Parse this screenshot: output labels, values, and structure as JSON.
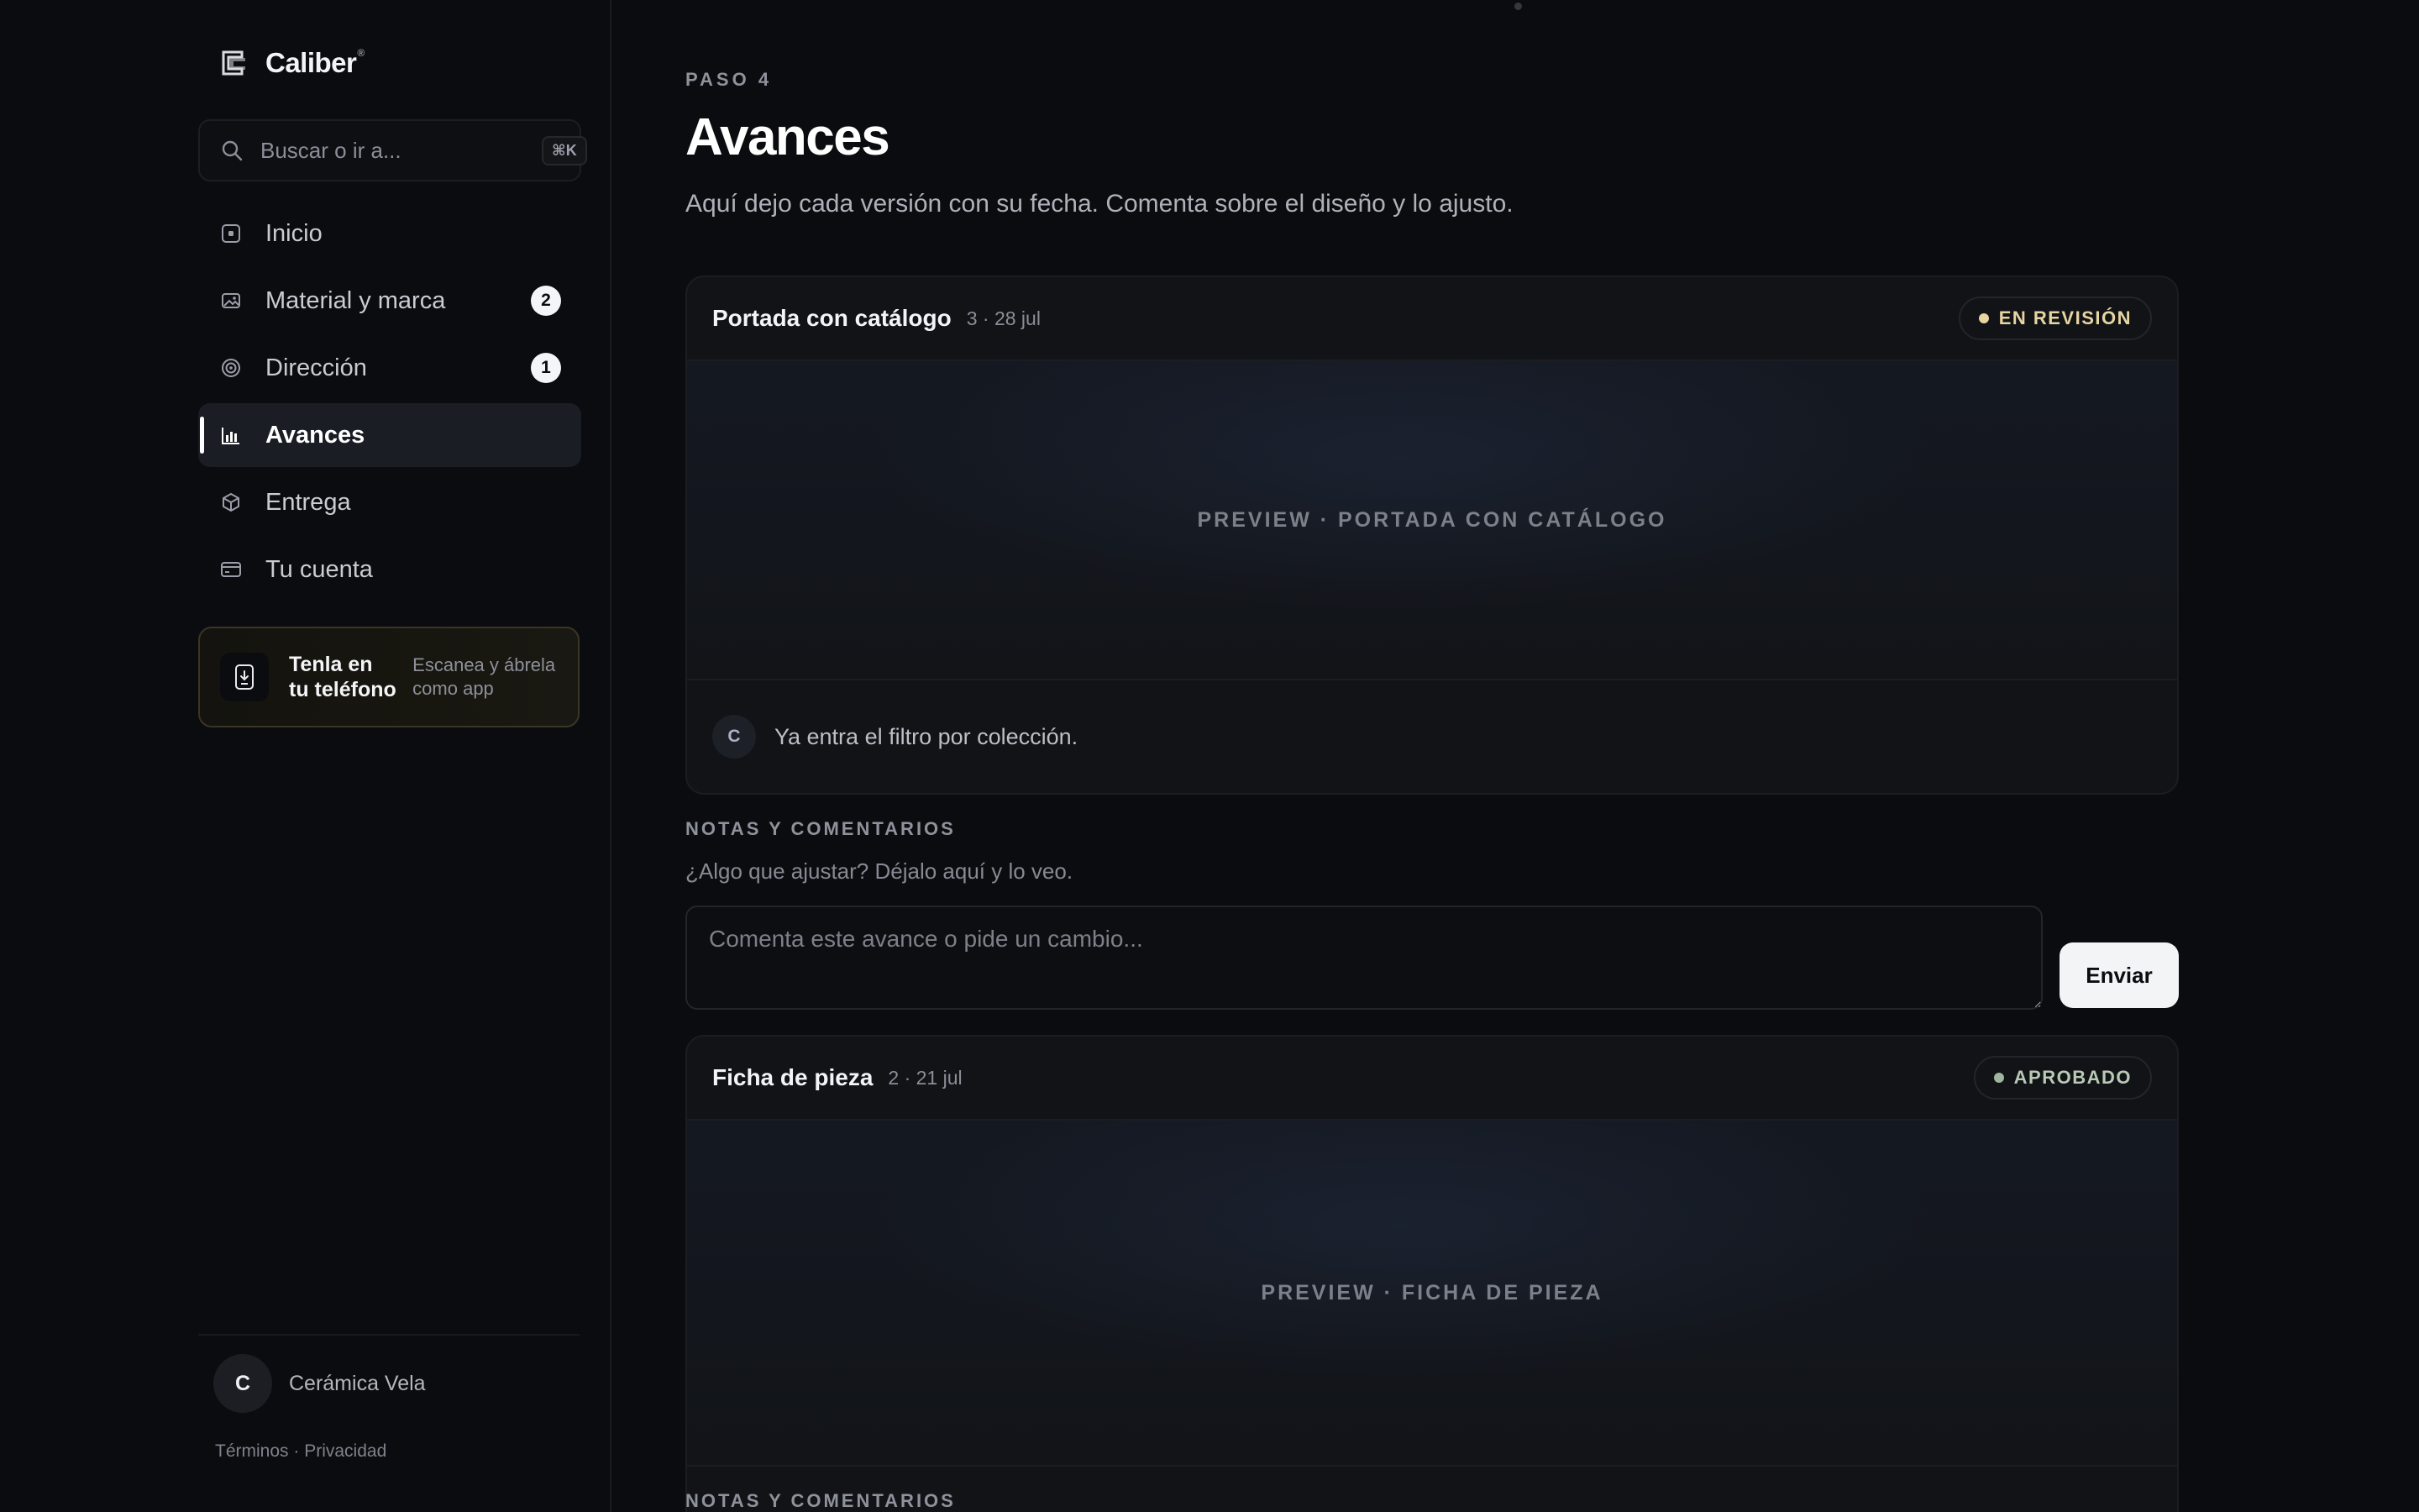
{
  "brand": {
    "name": "Caliber",
    "reg": "®"
  },
  "search": {
    "placeholder": "Buscar o ir a...",
    "shortcut": "⌘K"
  },
  "nav": {
    "items": [
      {
        "label": "Inicio",
        "icon": "home-icon"
      },
      {
        "label": "Material y marca",
        "icon": "image-icon",
        "badge": "2"
      },
      {
        "label": "Dirección",
        "icon": "target-icon",
        "badge": "1"
      },
      {
        "label": "Avances",
        "icon": "bar-chart-icon",
        "active": true
      },
      {
        "label": "Entrega",
        "icon": "package-icon"
      },
      {
        "label": "Tu cuenta",
        "icon": "credit-card-icon"
      }
    ]
  },
  "app_card": {
    "title": "Tenla en tu teléfono",
    "subtitle": "Escanea y ábrela como app"
  },
  "account": {
    "initial": "C",
    "name": "Cerámica Vela"
  },
  "legal": {
    "terms": "Términos",
    "separator": " · ",
    "privacy": "Privacidad"
  },
  "page": {
    "step": "PASO 4",
    "title": "Avances",
    "subtitle": "Aquí dejo cada versión con su fecha. Comenta sobre el diseño y lo ajusto."
  },
  "versions": [
    {
      "title": "Portada con catálogo",
      "meta": "3 · 28 jul",
      "status": "EN REVISIÓN",
      "preview": "PREVIEW · PORTADA CON CATÁLOGO",
      "comment": {
        "initial": "C",
        "text": "Ya entra el filtro por colección."
      }
    },
    {
      "title": "Ficha de pieza",
      "meta": "2 · 21 jul",
      "status": "APROBADO",
      "preview": "PREVIEW · FICHA DE PIEZA"
    }
  ],
  "notes": {
    "title": "NOTAS Y COMENTARIOS",
    "subtitle": "¿Algo que ajustar? Déjalo aquí y lo veo.",
    "placeholder": "Comenta este avance o pide un cambio...",
    "send_label": "Enviar"
  },
  "colors": {
    "background": "#0b0c0f",
    "review_status": "#e7d5a2",
    "approved_status": "#9fb59c",
    "accent_white": "#f3f4f6"
  }
}
